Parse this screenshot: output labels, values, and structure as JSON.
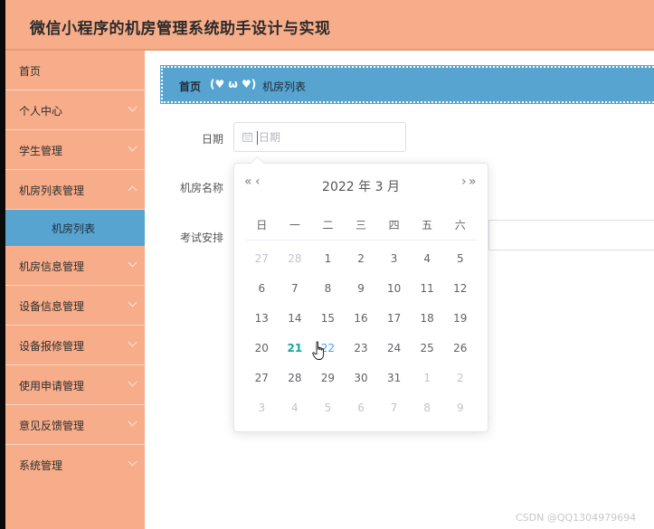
{
  "header": {
    "title": "微信小程序的机房管理系统助手设计与实现"
  },
  "sidebar": {
    "items": [
      {
        "label": "首页",
        "chevron": false
      },
      {
        "label": "个人中心",
        "chevron": true
      },
      {
        "label": "学生管理",
        "chevron": true
      },
      {
        "label": "机房列表管理",
        "chevron": true
      }
    ],
    "sub_item": {
      "label": "机房列表"
    },
    "items_after": [
      {
        "label": "机房信息管理"
      },
      {
        "label": "设备信息管理"
      },
      {
        "label": "设备报修管理"
      },
      {
        "label": "使用申请管理"
      },
      {
        "label": "意见反馈管理"
      },
      {
        "label": "系统管理"
      }
    ]
  },
  "breadcrumb": {
    "home": "首页",
    "separator": "(♥ ω ♥)",
    "current": "机房列表"
  },
  "form": {
    "date_label": "日期",
    "date_placeholder": "日期",
    "room_name_label": "机房名称",
    "exam_label": "考试安排"
  },
  "datepicker": {
    "prev_year": "«",
    "prev_month": "‹",
    "next_month": "›",
    "next_year": "»",
    "year_label": "2022 年",
    "month_label": "3 月",
    "weekdays": [
      "日",
      "一",
      "二",
      "三",
      "四",
      "五",
      "六"
    ],
    "weeks": [
      [
        [
          "27",
          "other"
        ],
        [
          "28",
          "other"
        ],
        [
          "1",
          ""
        ],
        [
          "2",
          ""
        ],
        [
          "3",
          ""
        ],
        [
          "4",
          ""
        ],
        [
          "5",
          ""
        ]
      ],
      [
        [
          "6",
          ""
        ],
        [
          "7",
          ""
        ],
        [
          "8",
          ""
        ],
        [
          "9",
          ""
        ],
        [
          "10",
          ""
        ],
        [
          "11",
          ""
        ],
        [
          "12",
          ""
        ]
      ],
      [
        [
          "13",
          ""
        ],
        [
          "14",
          ""
        ],
        [
          "15",
          ""
        ],
        [
          "16",
          ""
        ],
        [
          "17",
          ""
        ],
        [
          "18",
          ""
        ],
        [
          "19",
          ""
        ]
      ],
      [
        [
          "20",
          ""
        ],
        [
          "21",
          "today"
        ],
        [
          "22",
          "hover"
        ],
        [
          "23",
          ""
        ],
        [
          "24",
          ""
        ],
        [
          "25",
          ""
        ],
        [
          "26",
          ""
        ]
      ],
      [
        [
          "27",
          ""
        ],
        [
          "28",
          ""
        ],
        [
          "29",
          ""
        ],
        [
          "30",
          ""
        ],
        [
          "31",
          ""
        ],
        [
          "1",
          "other"
        ],
        [
          "2",
          "other"
        ]
      ],
      [
        [
          "3",
          "other"
        ],
        [
          "4",
          "other"
        ],
        [
          "5",
          "other"
        ],
        [
          "6",
          "other"
        ],
        [
          "7",
          "other"
        ],
        [
          "8",
          "other"
        ],
        [
          "9",
          "other"
        ]
      ]
    ]
  },
  "watermark": "CSDN @QQ1304979694",
  "colors": {
    "header_bg": "#f8ad8a",
    "sidebar_bg": "#f8ad8a",
    "active_bg": "#57a4d1",
    "today": "#13a89e"
  }
}
